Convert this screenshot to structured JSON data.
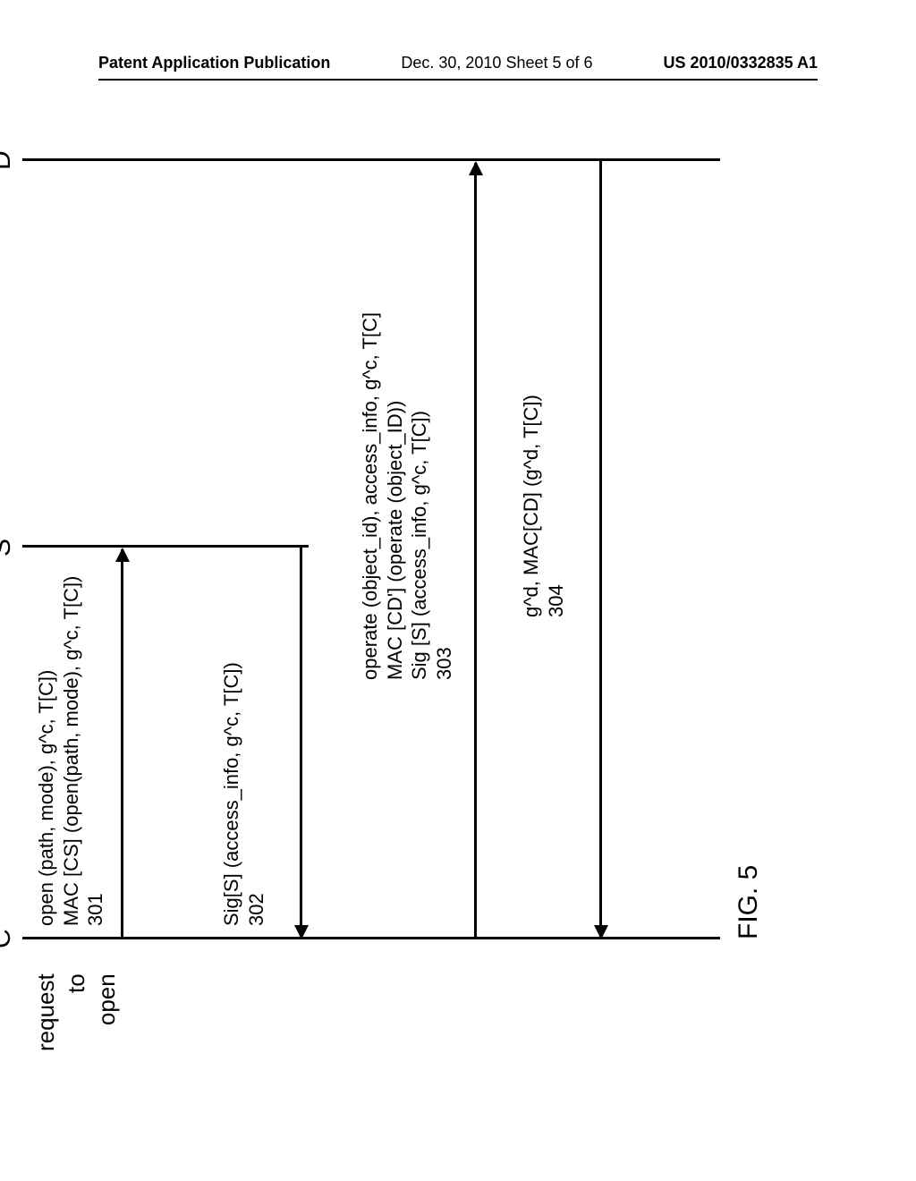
{
  "header": {
    "left": "Patent Application Publication",
    "center": "Dec. 30, 2010  Sheet 5 of 6",
    "right": "US 2010/0332835 A1"
  },
  "entities": {
    "c": "C",
    "s": "S",
    "d": "D"
  },
  "side": {
    "l1": "request",
    "l2": "to",
    "l3": "open"
  },
  "msg301": {
    "l1": "open (path, mode), g^c, T[C])",
    "l2": "MAC [CS] (open(path, mode), g^c, T[C])",
    "l3": "301"
  },
  "msg302": {
    "l1": "Sig[S] (access_info, g^c, T[C])",
    "l2": "302"
  },
  "msg303": {
    "l1": "operate (object_id), access_info, g^c, T[C]",
    "l2": "MAC [CD'] (operate (object_ID))",
    "l3": "Sig [S] (access_info, g^c, T[C])",
    "l4": "303"
  },
  "msg304": {
    "l1": "g^d, MAC[CD] (g^d, T[C])",
    "l2": "304"
  },
  "figure": "FIG. 5"
}
